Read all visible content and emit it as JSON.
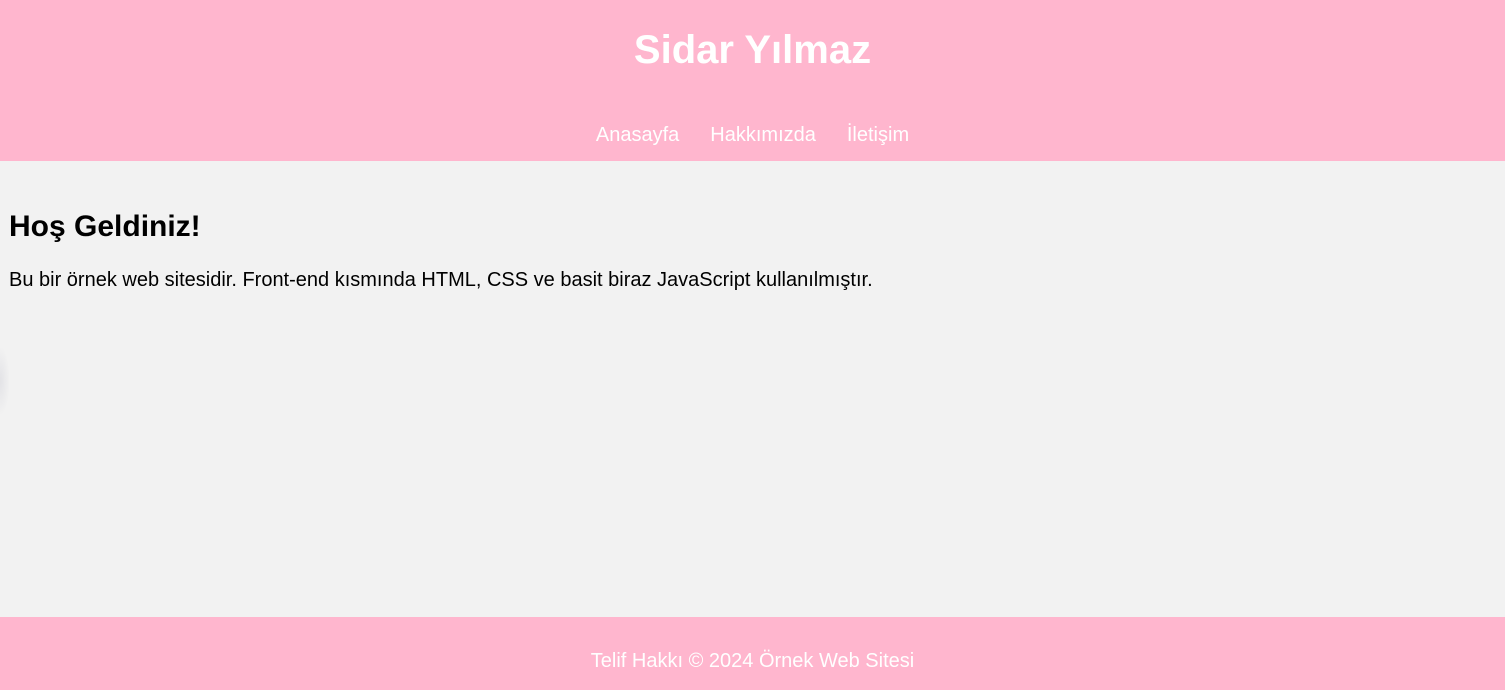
{
  "header": {
    "title": "Sidar Yılmaz",
    "background_color": "#ffb6ce"
  },
  "nav": {
    "items": [
      {
        "label": "Anasayfa"
      },
      {
        "label": "Hakkımızda"
      },
      {
        "label": "İletişim"
      }
    ]
  },
  "main": {
    "heading": "Hoş Geldiniz!",
    "intro": "Bu bir örnek web sitesidir. Front-end kısmında HTML, CSS ve basit biraz JavaScript kullanılmıştır.",
    "background_color": "#f2f2f2"
  },
  "footer": {
    "text": "Telif Hakkı © 2024 Örnek Web Sitesi",
    "background_color": "#ffb6ce"
  }
}
